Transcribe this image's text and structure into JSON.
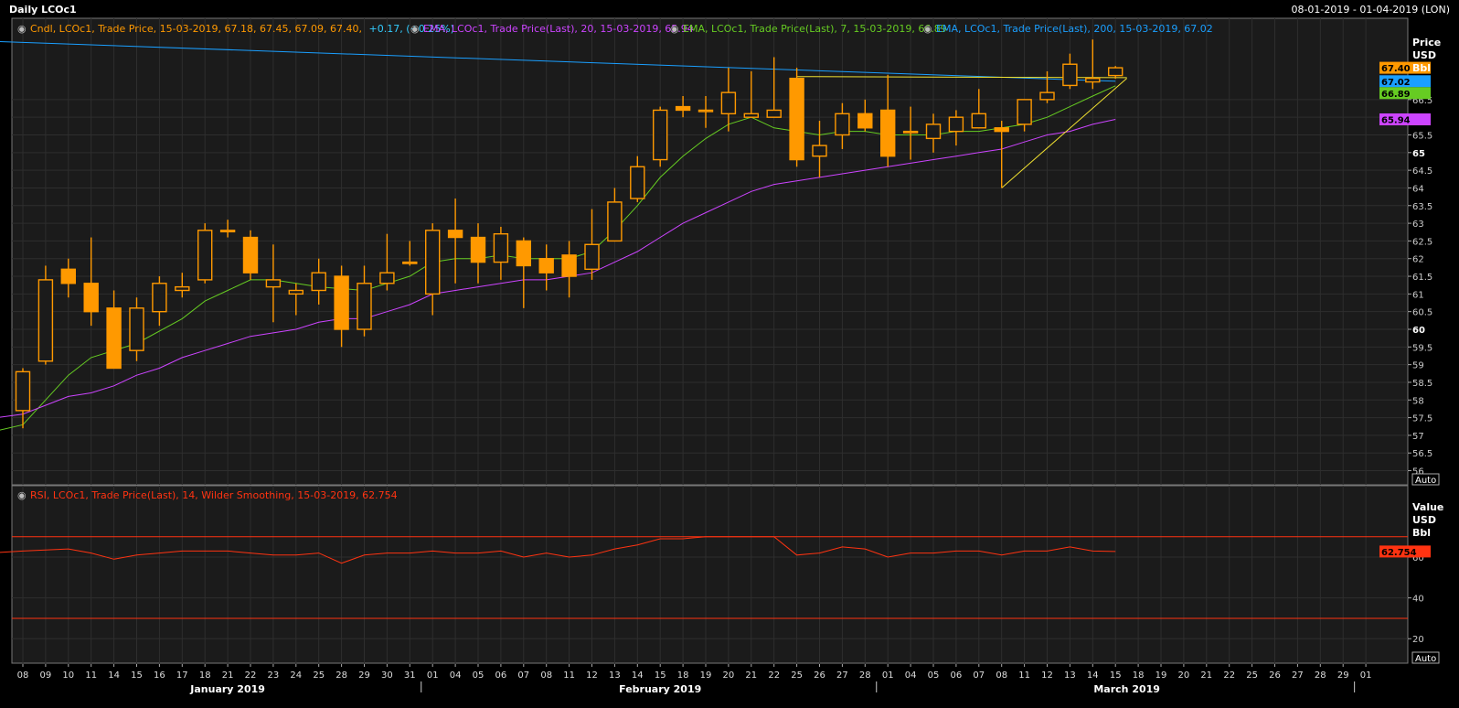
{
  "window": {
    "title": "Daily LCOc1",
    "date_range": "08-01-2019 - 01-04-2019 (LON)"
  },
  "legend": {
    "candle": {
      "prefix": "Cndl, LCOc1, Trade Price, 15-03-2019, 67.18, 67.45, 67.09, 67.40,",
      "change": "+0.17, (+0.25%)",
      "color": "#ff9900",
      "change_color": "#33ccff"
    },
    "ema20": {
      "text": "EMA, LCOc1, Trade Price(Last), 20, 15-03-2019, 65.94",
      "color": "#cc44ff"
    },
    "ema7": {
      "text": "EMA, LCOc1, Trade Price(Last), 7, 15-03-2019, 66.89",
      "color": "#66cc22"
    },
    "ema200": {
      "text": "EMA, LCOc1, Trade Price(Last), 200, 15-03-2019, 67.02",
      "color": "#1a9fff"
    },
    "rsi": {
      "text": "RSI, LCOc1, Trade Price(Last), 14, Wilder Smoothing, 15-03-2019, 62.754",
      "color": "#ff3311"
    }
  },
  "price_axis": {
    "header": [
      "Price",
      "USD",
      "Bbl"
    ],
    "auto_label": "Auto",
    "badges": [
      {
        "text": "67.40",
        "value": 67.4,
        "color": "#ff9900"
      },
      {
        "text": "67.02",
        "value": 67.02,
        "color": "#1a9fff"
      },
      {
        "text": "66.89",
        "value": 66.89,
        "color": "#66cc22"
      },
      {
        "text": "65.94",
        "value": 65.94,
        "color": "#cc44ff"
      }
    ]
  },
  "rsi_axis": {
    "header": [
      "Value",
      "USD",
      "Bbl"
    ],
    "auto_label": "Auto",
    "badge": {
      "text": "62.754",
      "value": 62.754,
      "color": "#ff3311"
    }
  },
  "x_axis": {
    "day_labels": [
      "08",
      "09",
      "10",
      "11",
      "14",
      "15",
      "16",
      "17",
      "18",
      "21",
      "22",
      "23",
      "24",
      "25",
      "28",
      "29",
      "30",
      "31",
      "01",
      "04",
      "05",
      "06",
      "07",
      "08",
      "11",
      "12",
      "13",
      "14",
      "15",
      "18",
      "19",
      "20",
      "21",
      "22",
      "25",
      "26",
      "27",
      "28",
      "01",
      "04",
      "05",
      "06",
      "07",
      "08",
      "11",
      "12",
      "13",
      "14",
      "15",
      "18",
      "19",
      "20",
      "21",
      "22",
      "25",
      "26",
      "27",
      "28",
      "29",
      "01"
    ],
    "months": [
      {
        "label": "January 2019",
        "center_index": 9
      },
      {
        "label": "February 2019",
        "center_index": 28
      },
      {
        "label": "March 2019",
        "center_index": 48.5
      }
    ],
    "month_dividers": [
      18,
      38,
      59
    ]
  },
  "chart_data": [
    {
      "type": "candlestick",
      "title": "Daily LCOc1",
      "ylabel": "Price USD Bbl",
      "ylim": [
        55.6,
        68.8
      ],
      "yticks": [
        56,
        56.5,
        57,
        57.5,
        58,
        58.5,
        59,
        59.5,
        60,
        60.5,
        61,
        61.5,
        62,
        62.5,
        63,
        63.5,
        64,
        64.5,
        65,
        65.5,
        66,
        66.5
      ],
      "bold_ticks": [
        60,
        65
      ],
      "grid": true,
      "dates": [
        "08-01",
        "09-01",
        "10-01",
        "11-01",
        "14-01",
        "15-01",
        "16-01",
        "17-01",
        "18-01",
        "21-01",
        "22-01",
        "23-01",
        "24-01",
        "25-01",
        "28-01",
        "29-01",
        "30-01",
        "31-01",
        "01-02",
        "04-02",
        "05-02",
        "06-02",
        "07-02",
        "08-02",
        "11-02",
        "12-02",
        "13-02",
        "14-02",
        "15-02",
        "18-02",
        "19-02",
        "20-02",
        "21-02",
        "22-02",
        "25-02",
        "26-02",
        "27-02",
        "28-02",
        "01-03",
        "04-03",
        "05-03",
        "06-03",
        "07-03",
        "08-03",
        "11-03",
        "12-03",
        "13-03",
        "14-03",
        "15-03"
      ],
      "open": [
        57.7,
        59.1,
        61.7,
        61.3,
        60.6,
        59.4,
        60.5,
        61.1,
        61.4,
        62.8,
        62.6,
        61.2,
        61.0,
        61.1,
        61.5,
        60.0,
        61.3,
        61.9,
        61.0,
        62.8,
        62.6,
        61.9,
        62.5,
        62.0,
        62.1,
        61.7,
        62.5,
        63.7,
        64.8,
        66.3,
        66.2,
        66.1,
        66.0,
        66.0,
        67.1,
        64.9,
        65.5,
        66.1,
        66.2,
        65.6,
        65.4,
        65.6,
        65.7,
        65.7,
        65.8,
        66.5,
        66.9,
        67.0,
        67.18
      ],
      "high": [
        58.9,
        61.8,
        62.0,
        62.6,
        61.1,
        60.9,
        61.5,
        61.6,
        63.0,
        63.1,
        62.8,
        62.4,
        61.3,
        62.0,
        61.8,
        61.8,
        62.7,
        62.5,
        63.0,
        63.7,
        63.0,
        62.9,
        62.6,
        62.4,
        62.5,
        63.4,
        64.0,
        64.9,
        66.3,
        66.6,
        66.6,
        67.4,
        67.3,
        67.7,
        67.4,
        65.9,
        66.4,
        66.5,
        67.2,
        66.3,
        66.1,
        66.2,
        66.8,
        65.9,
        66.5,
        67.3,
        67.8,
        68.2,
        67.45
      ],
      "low": [
        57.2,
        59.0,
        60.9,
        60.1,
        59.0,
        59.1,
        60.1,
        60.9,
        61.3,
        62.6,
        61.4,
        60.2,
        60.4,
        60.7,
        59.5,
        59.8,
        61.1,
        61.8,
        60.4,
        61.3,
        61.3,
        61.4,
        60.6,
        61.1,
        60.9,
        61.4,
        62.5,
        63.6,
        64.6,
        66.0,
        65.7,
        65.6,
        66.0,
        66.2,
        64.6,
        64.3,
        65.1,
        65.6,
        64.6,
        64.8,
        65.0,
        65.2,
        65.7,
        64.0,
        65.6,
        66.4,
        66.8,
        66.8,
        67.09
      ],
      "close": [
        58.8,
        61.4,
        61.3,
        60.5,
        58.9,
        60.6,
        61.3,
        61.2,
        62.8,
        62.8,
        61.6,
        61.4,
        61.1,
        61.6,
        60.0,
        61.3,
        61.6,
        61.9,
        62.8,
        62.6,
        61.9,
        62.7,
        61.8,
        61.6,
        61.5,
        62.4,
        63.6,
        64.6,
        66.2,
        66.2,
        66.2,
        66.7,
        66.1,
        66.2,
        64.8,
        65.2,
        66.1,
        65.7,
        64.9,
        65.6,
        65.8,
        66.0,
        66.1,
        65.6,
        66.5,
        66.7,
        67.5,
        67.1,
        67.4
      ],
      "series": [
        {
          "name": "EMA 200",
          "color": "#1a9fff",
          "x": [
            -8,
            47,
            48
          ],
          "y": [
            68.3,
            67.04,
            67.02
          ]
        },
        {
          "name": "EMA 7",
          "color": "#66cc22",
          "x": [
            -8,
            0,
            2,
            3,
            5,
            7,
            8,
            9,
            10,
            11,
            12,
            13,
            15,
            16,
            17,
            18,
            19,
            20,
            21,
            22,
            23,
            24,
            25,
            26,
            27,
            28,
            29,
            30,
            31,
            32,
            33,
            34,
            35,
            36,
            37,
            38,
            39,
            40,
            41,
            42,
            43,
            44,
            45,
            46,
            47,
            48
          ],
          "y": [
            56.1,
            57.3,
            58.7,
            59.2,
            59.6,
            60.3,
            60.8,
            61.1,
            61.4,
            61.4,
            61.3,
            61.2,
            61.1,
            61.3,
            61.5,
            61.9,
            62.0,
            62.0,
            62.1,
            62.0,
            62.0,
            62.0,
            62.2,
            62.8,
            63.5,
            64.3,
            64.9,
            65.4,
            65.8,
            66.0,
            65.7,
            65.6,
            65.5,
            65.6,
            65.6,
            65.5,
            65.5,
            65.5,
            65.6,
            65.6,
            65.7,
            65.8,
            66.0,
            66.3,
            66.6,
            66.89
          ]
        },
        {
          "name": "EMA 20",
          "color": "#cc44ff",
          "x": [
            -8,
            0,
            2,
            3,
            4,
            5,
            6,
            7,
            8,
            9,
            10,
            11,
            12,
            13,
            14,
            15,
            16,
            17,
            18,
            19,
            20,
            21,
            22,
            23,
            24,
            25,
            26,
            27,
            28,
            29,
            30,
            31,
            32,
            33,
            34,
            35,
            36,
            37,
            38,
            39,
            40,
            41,
            42,
            43,
            44,
            45,
            46,
            47,
            48
          ],
          "y": [
            56.9,
            57.6,
            58.1,
            58.2,
            58.4,
            58.7,
            58.9,
            59.2,
            59.4,
            59.6,
            59.8,
            59.9,
            60.0,
            60.2,
            60.3,
            60.3,
            60.5,
            60.7,
            61.0,
            61.1,
            61.2,
            61.3,
            61.4,
            61.4,
            61.5,
            61.6,
            61.9,
            62.2,
            62.6,
            63.0,
            63.3,
            63.6,
            63.9,
            64.1,
            64.2,
            64.3,
            64.4,
            64.5,
            64.6,
            64.7,
            64.8,
            64.9,
            65.0,
            65.1,
            65.3,
            65.5,
            65.6,
            65.8,
            65.94
          ]
        }
      ],
      "trendlines": [
        {
          "color": "#f0e030",
          "x": [
            34,
            48.5
          ],
          "y": [
            67.15,
            67.12
          ]
        },
        {
          "color": "#f0e030",
          "x": [
            43,
            48.5
          ],
          "y": [
            64.0,
            67.1
          ]
        }
      ]
    },
    {
      "type": "line",
      "title": "RSI, LCOc1, Trade Price(Last), 14, Wilder Smoothing",
      "ylabel": "Value USD Bbl",
      "ylim": [
        8,
        95
      ],
      "yticks": [
        20,
        40,
        60
      ],
      "levels": [
        30,
        70
      ],
      "grid": true,
      "series": [
        {
          "name": "RSI",
          "color": "#ff3311",
          "x": [
            -8,
            -6,
            0,
            2,
            3,
            4,
            5,
            6,
            7,
            8,
            9,
            10,
            11,
            12,
            13,
            14,
            15,
            16,
            17,
            18,
            19,
            20,
            21,
            22,
            23,
            24,
            25,
            26,
            27,
            28,
            29,
            30,
            31,
            32,
            33,
            34,
            35,
            36,
            37,
            38,
            39,
            40,
            41,
            42,
            43,
            44,
            45,
            46,
            47,
            48
          ],
          "y": [
            58,
            59,
            63,
            64,
            62,
            59,
            61,
            62,
            63,
            63,
            63,
            62,
            61,
            61,
            62,
            57,
            61,
            62,
            62,
            63,
            62,
            62,
            63,
            60,
            62,
            60,
            61,
            64,
            66,
            69,
            69,
            70,
            70,
            70,
            70,
            61,
            62,
            65,
            64,
            60,
            62,
            62,
            63,
            63,
            61,
            63,
            63,
            65,
            63,
            62.754
          ]
        }
      ]
    }
  ]
}
